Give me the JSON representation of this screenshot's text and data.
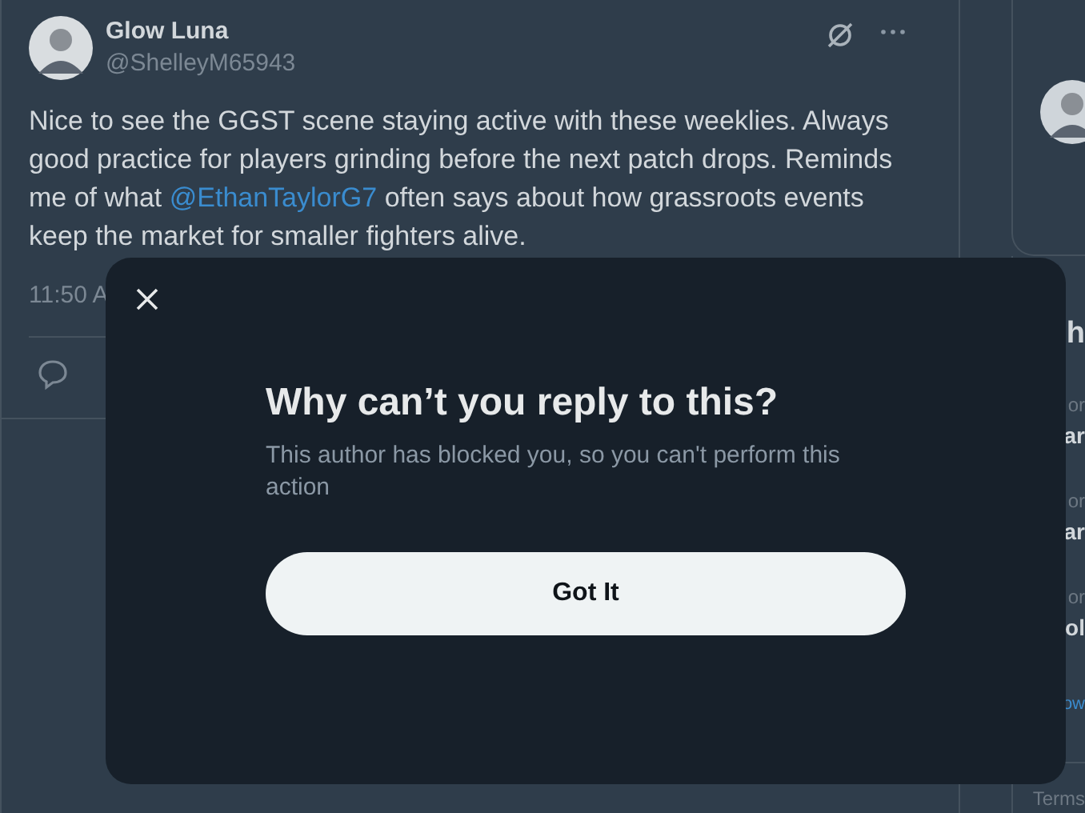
{
  "tweet": {
    "author": "Glow Luna",
    "handle": "@ShelleyM65943",
    "text": [
      {
        "kind": "text",
        "text": "Nice to see the GGST scene staying active with these weeklies. Always good practice for players grinding before the next patch drops. Reminds me of what "
      },
      {
        "kind": "mention",
        "text": "@EthanTaylorG7"
      },
      {
        "kind": "text",
        "text": " often says about how grassroots events keep the market for smaller fighters alive."
      }
    ],
    "time": "11:50 A"
  },
  "sidebar": {
    "heading": "h",
    "items": [
      {
        "category": "or",
        "title": "ar"
      },
      {
        "category": "or",
        "title": "ar"
      },
      {
        "category": "or",
        "title": "ol"
      }
    ],
    "link": "ow",
    "footer": "Terms"
  },
  "modal": {
    "title": "Why can’t you reply to this?",
    "message": "This author has blocked you, so you can't perform this action",
    "button": "Got It"
  }
}
